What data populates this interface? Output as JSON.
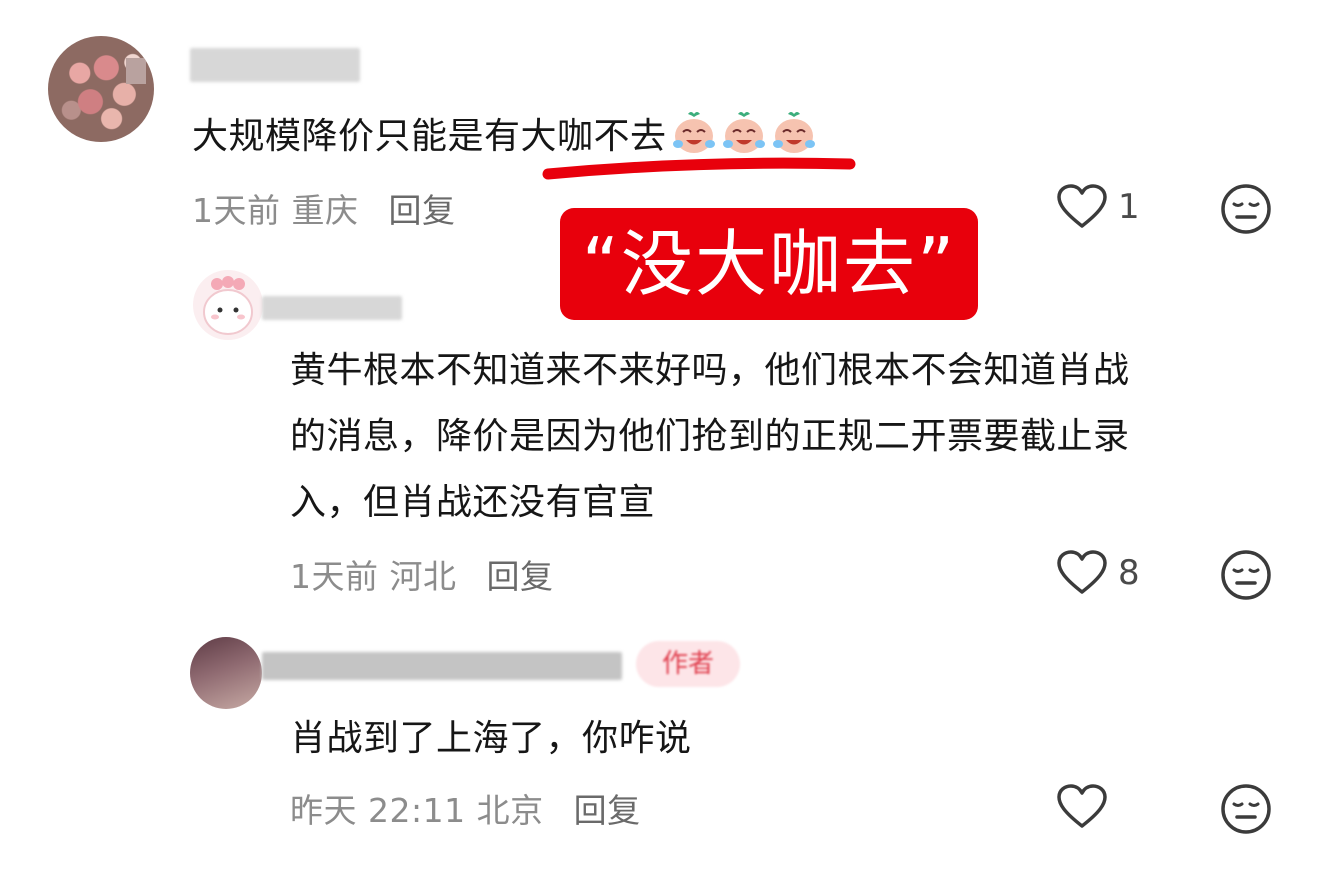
{
  "comments": [
    {
      "text": "大规模降价只能是有大咖不去",
      "meta": "1天前 重庆",
      "reply": "回复",
      "likes": "1",
      "emoji_count": 3
    },
    {
      "text_lines": [
        "黄牛根本不知道来不来好吗，他们根本不会知道肖战",
        "的消息，降价是因为他们抢到的正规二开票要截止录",
        "入，但肖战还没有官宣"
      ],
      "meta": "1天前 河北",
      "reply": "回复",
      "likes": "8"
    },
    {
      "text": "肖战到了上海了，你咋说",
      "meta": "昨天 22:11 北京",
      "reply": "回复",
      "likes": "",
      "badge": "作者"
    }
  ],
  "annotation": {
    "banner_text": "“没大咖去”",
    "underline_color": "#e8000c",
    "banner_color": "#e8000c"
  },
  "icons": {
    "like": "heart-outline-icon",
    "dislike": "neutral-face-icon",
    "emoji": "crying-laughing-emoji-icon"
  }
}
